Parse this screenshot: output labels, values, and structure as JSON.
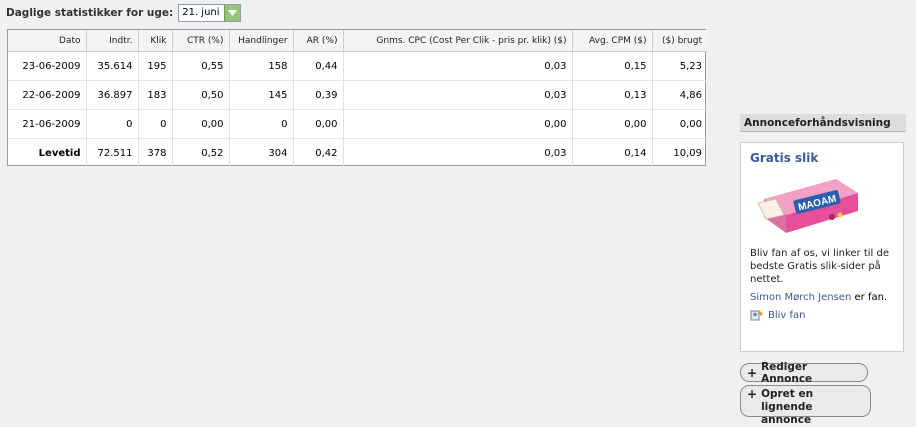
{
  "week": {
    "label": "Daglige statistikker for uge:",
    "selected": "21. juni"
  },
  "table": {
    "headers": [
      "Dato",
      "Indtr.",
      "Klik",
      "CTR (%)",
      "Handlinger",
      "AR (%)",
      "Gnms. CPC (Cost Per Clik - pris pr. klik) ($)",
      "Avg. CPM ($)",
      "($) brugt"
    ],
    "rows": [
      [
        "23-06-2009",
        "35.614",
        "195",
        "0,55",
        "158",
        "0,44",
        "0,03",
        "0,15",
        "5,23"
      ],
      [
        "22-06-2009",
        "36.897",
        "183",
        "0,50",
        "145",
        "0,39",
        "0,03",
        "0,13",
        "4,86"
      ],
      [
        "21-06-2009",
        "0",
        "0",
        "0,00",
        "0",
        "0,00",
        "0,00",
        "0,00",
        "0,00"
      ],
      [
        "Levetid",
        "72.511",
        "378",
        "0,52",
        "304",
        "0,42",
        "0,03",
        "0,14",
        "10,09"
      ]
    ]
  },
  "preview": {
    "title": "Annonceforhåndsvisning",
    "ad_headline": "Gratis slik",
    "ad_body": "Bliv fan af os, vi linker til de bedste Gratis slik-sider på nettet.",
    "social_name": "Simon Mørch Jensen",
    "social_suffix": " er fan.",
    "like_label": "Bliv fan",
    "image_brand_text": "MAOAM"
  },
  "buttons": {
    "edit_label": "Rediger Annonce",
    "create_label": "Opret en lignende annonce"
  },
  "colors": {
    "link": "#3b5998",
    "select_arrow": "#98c47a"
  }
}
